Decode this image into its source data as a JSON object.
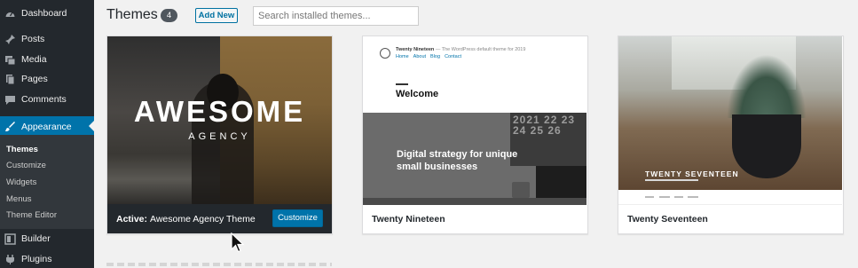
{
  "sidebar": {
    "items": [
      {
        "label": "Dashboard",
        "icon": "dashboard-icon"
      },
      {
        "label": "Posts",
        "icon": "pin-icon"
      },
      {
        "label": "Media",
        "icon": "media-icon"
      },
      {
        "label": "Pages",
        "icon": "pages-icon"
      },
      {
        "label": "Comments",
        "icon": "comment-icon"
      },
      {
        "label": "Appearance",
        "icon": "brush-icon"
      },
      {
        "label": "Builder",
        "icon": "builder-icon"
      },
      {
        "label": "Plugins",
        "icon": "plug-icon"
      }
    ],
    "submenu": [
      "Themes",
      "Customize",
      "Widgets",
      "Menus",
      "Theme Editor"
    ],
    "accent_color": "#0073aa"
  },
  "header": {
    "title": "Themes",
    "count": "4",
    "add_new_label": "Add New",
    "search_placeholder": "Search installed themes..."
  },
  "themes": [
    {
      "name": "Awesome Agency Theme",
      "active_prefix": "Active:",
      "customize_label": "Customize",
      "screenshot_title": "AWESOME",
      "screenshot_subtitle": "AGENCY"
    },
    {
      "name": "Twenty Nineteen",
      "screenshot_site": "Twenty Nineteen",
      "screenshot_tagline": "— The WordPress default theme for 2019",
      "screenshot_nav": [
        "Home",
        "About",
        "Blog",
        "Contact"
      ],
      "screenshot_heading": "Welcome",
      "screenshot_hero": "Digital strategy for unique small businesses",
      "screenshot_calendar": "2021 22 23 24 25 26"
    },
    {
      "name": "Twenty Seventeen",
      "screenshot_title": "TWENTY SEVENTEEN"
    }
  ]
}
